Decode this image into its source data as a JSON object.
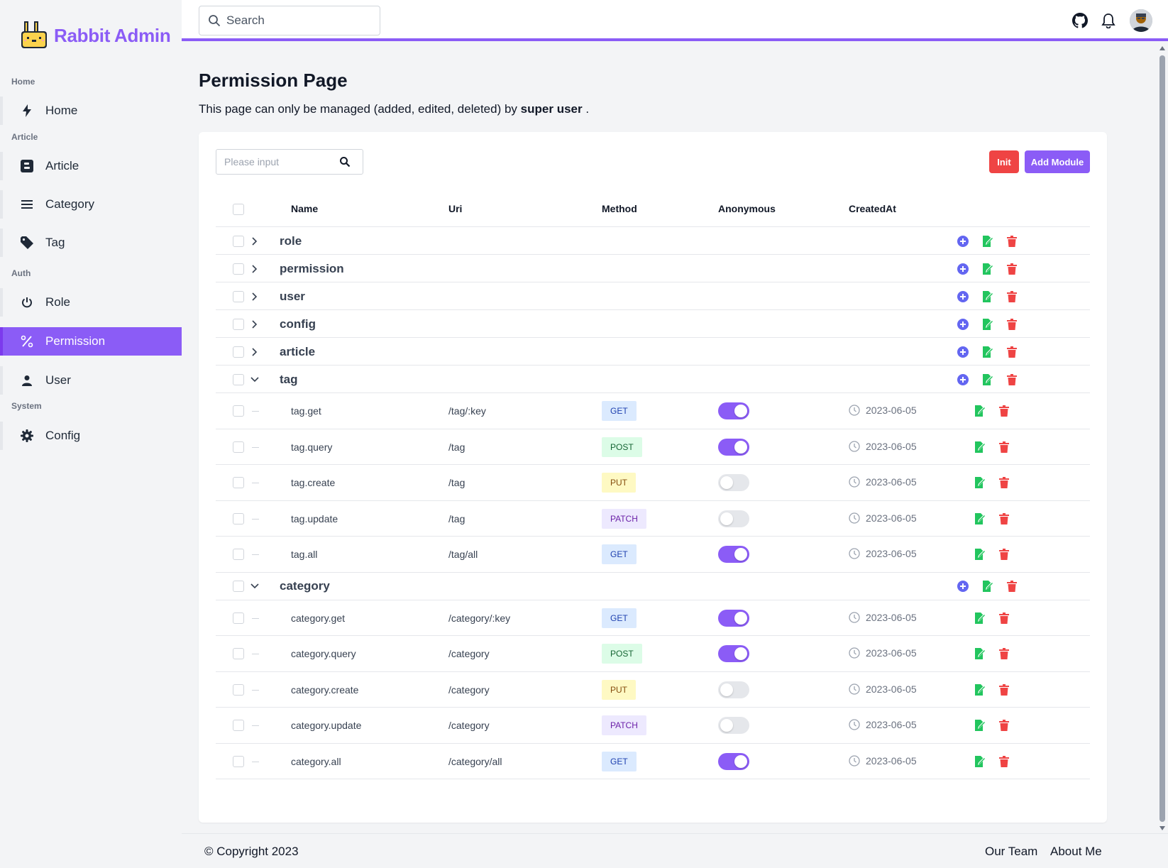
{
  "brand": {
    "name": "Rabbit Admin"
  },
  "header": {
    "search_placeholder": "Search"
  },
  "sidebar": {
    "sections": [
      {
        "label": "Home"
      },
      {
        "label": "Article"
      },
      {
        "label": "Auth"
      },
      {
        "label": "System"
      }
    ],
    "items": [
      {
        "label": "Home",
        "icon": "bolt-icon"
      },
      {
        "label": "Article",
        "icon": "blogger-icon"
      },
      {
        "label": "Category",
        "icon": "menu-icon"
      },
      {
        "label": "Tag",
        "icon": "tag-icon"
      },
      {
        "label": "Role",
        "icon": "power-icon"
      },
      {
        "label": "Permission",
        "icon": "percent-icon",
        "active": true
      },
      {
        "label": "User",
        "icon": "user-icon"
      },
      {
        "label": "Config",
        "icon": "gear-icon"
      }
    ]
  },
  "page": {
    "title": "Permission Page",
    "desc_prefix": "This page can only be managed (added, edited, deleted) by",
    "desc_bold": "super user",
    "desc_suffix": "."
  },
  "table": {
    "search_placeholder": "Please input",
    "init_label": "Init",
    "add_module_label": "Add Module",
    "columns": [
      "Name",
      "Uri",
      "Method",
      "Anonymous",
      "CreatedAt"
    ],
    "modules": [
      {
        "name": "role",
        "expanded": false
      },
      {
        "name": "permission",
        "expanded": false
      },
      {
        "name": "user",
        "expanded": false
      },
      {
        "name": "config",
        "expanded": false
      },
      {
        "name": "article",
        "expanded": false
      },
      {
        "name": "tag",
        "expanded": true,
        "children": [
          {
            "name": "tag.get",
            "uri": "/tag/:key",
            "method": "GET",
            "anonymous": true,
            "created": "2023-06-05"
          },
          {
            "name": "tag.query",
            "uri": "/tag",
            "method": "POST",
            "anonymous": true,
            "created": "2023-06-05"
          },
          {
            "name": "tag.create",
            "uri": "/tag",
            "method": "PUT",
            "anonymous": false,
            "created": "2023-06-05"
          },
          {
            "name": "tag.update",
            "uri": "/tag",
            "method": "PATCH",
            "anonymous": false,
            "created": "2023-06-05"
          },
          {
            "name": "tag.all",
            "uri": "/tag/all",
            "method": "GET",
            "anonymous": true,
            "created": "2023-06-05"
          }
        ]
      },
      {
        "name": "category",
        "expanded": true,
        "children": [
          {
            "name": "category.get",
            "uri": "/category/:key",
            "method": "GET",
            "anonymous": true,
            "created": "2023-06-05"
          },
          {
            "name": "category.query",
            "uri": "/category",
            "method": "POST",
            "anonymous": true,
            "created": "2023-06-05"
          },
          {
            "name": "category.create",
            "uri": "/category",
            "method": "PUT",
            "anonymous": false,
            "created": "2023-06-05"
          },
          {
            "name": "category.update",
            "uri": "/category",
            "method": "PATCH",
            "anonymous": false,
            "created": "2023-06-05"
          },
          {
            "name": "category.all",
            "uri": "/category/all",
            "method": "GET",
            "anonymous": true,
            "created": "2023-06-05"
          }
        ]
      }
    ]
  },
  "method_colors": {
    "GET": {
      "bg": "#dbeafe",
      "fg": "#1e40af"
    },
    "POST": {
      "bg": "#dcfce7",
      "fg": "#166534"
    },
    "PUT": {
      "bg": "#fef9c3",
      "fg": "#854d0e"
    },
    "PATCH": {
      "bg": "#ede9fe",
      "fg": "#6b21a8"
    }
  },
  "colors": {
    "accent": "#8b5cf6",
    "danger": "#ef4444",
    "edit": "#22c55e",
    "add": "#6366f1"
  },
  "footer": {
    "copyright": "© Copyright 2023",
    "links": [
      "Our Team",
      "About Me"
    ]
  }
}
